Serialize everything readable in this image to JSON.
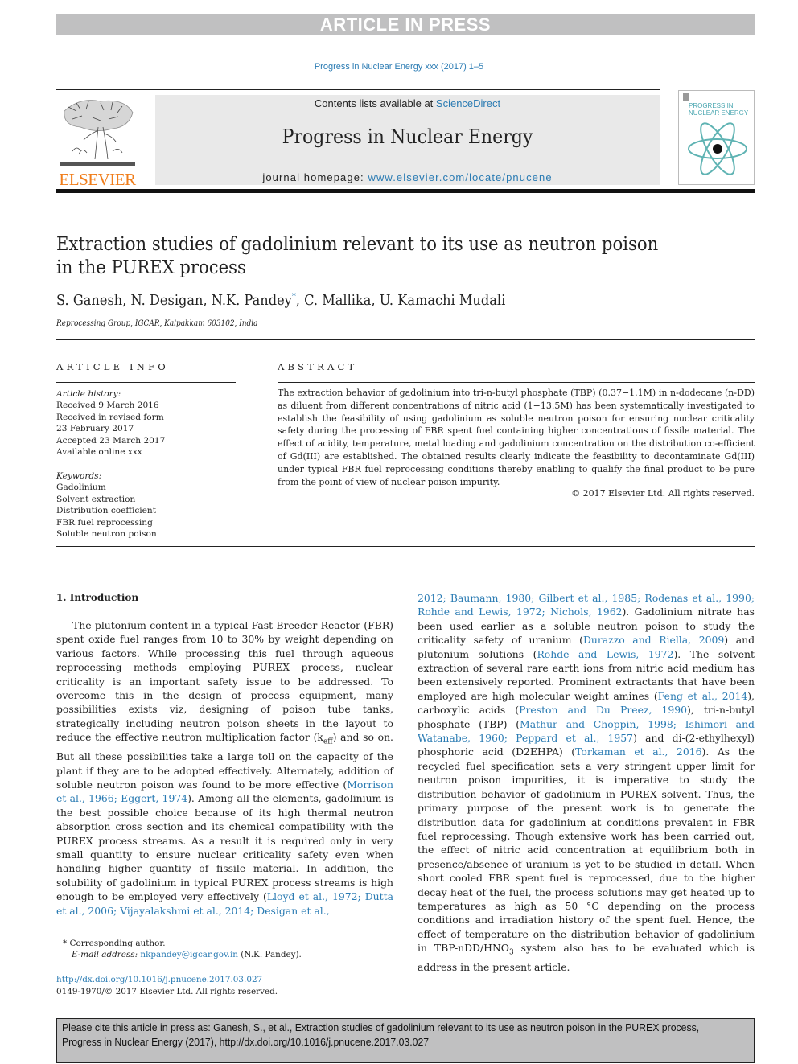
{
  "banner": "ARTICLE IN PRESS",
  "journal_ref": "Progress in Nuclear Energy xxx (2017) 1–5",
  "header": {
    "publisher_logo_text": "ELSEVIER",
    "contents_prefix": "Contents lists available at ",
    "contents_link": "ScienceDirect",
    "journal_title": "Progress in Nuclear Energy",
    "homepage_prefix": "journal homepage: ",
    "homepage_link": "www.elsevier.com/locate/pnucene",
    "cover_title_line1": "PROGRESS IN",
    "cover_title_line2": "NUCLEAR ENERGY"
  },
  "article": {
    "title_line1": "Extraction studies of gadolinium relevant to its use as neutron poison",
    "title_line2": "in the PUREX process",
    "authors_before": "S. Ganesh, N. Desigan, N.K. Pandey",
    "author_mark": "*",
    "authors_after": ", C. Mallika, U. Kamachi Mudali",
    "affiliation": "Reprocessing Group, IGCAR, Kalpakkam 603102, India"
  },
  "article_info": {
    "heading": "ARTICLE INFO",
    "history_label": "Article history:",
    "history": [
      "Received 9 March 2016",
      "Received in revised form",
      "23 February 2017",
      "Accepted 23 March 2017",
      "Available online xxx"
    ],
    "keywords_label": "Keywords:",
    "keywords": [
      "Gadolinium",
      "Solvent extraction",
      "Distribution coefficient",
      "FBR fuel reprocessing",
      "Soluble neutron poison"
    ]
  },
  "abstract": {
    "heading": "ABSTRACT",
    "text": "The extraction behavior of gadolinium into tri-n-butyl phosphate (TBP) (0.37−1.1M) in n-dodecane (n-DD) as diluent from different concentrations of nitric acid (1−13.5M) has been systematically investigated to establish the feasibility of using gadolinium as soluble neutron poison for ensuring nuclear criticality safety during the processing of FBR spent fuel containing higher concentrations of fissile material. The effect of acidity, temperature, metal loading and gadolinium concentration on the distribution co-efficient of Gd(III) are established. The obtained results clearly indicate the feasibility to decontaminate Gd(III) under typical FBR fuel reprocessing conditions thereby enabling to qualify the final product to be pure from the point of view of nuclear poison impurity.",
    "copyright": "© 2017 Elsevier Ltd. All rights reserved."
  },
  "body": {
    "section_heading": "1.  Introduction",
    "left": {
      "t1": "The plutonium content in a typical Fast Breeder Reactor (FBR) spent oxide fuel ranges from 10 to 30% by weight depending on various factors. While processing this fuel through aqueous reprocessing methods employing PUREX process, nuclear criticality is an important safety issue to be addressed. To overcome this in the design of process equipment, many possibilities exists viz, designing of poison tube tanks, strategically including neutron poison sheets in the layout to reduce the effective neutron multiplication factor (k",
      "keff_sub": "eff",
      "t2": ") and so on. But all these possibilities take a large toll on the capacity of the plant if they are to be adopted effectively. Alternately, addition of soluble neutron poison was found to be more effective (",
      "ref1": "Morrison et al., 1966; Eggert, 1974",
      "t3": "). Among all the elements, gadolinium is the best possible choice because of its high thermal neutron absorption cross section and its chemical compatibility with the PUREX process streams. As a result it is required only in very small quantity to ensure nuclear criticality safety even when handling higher quantity of fissile material. In addition, the solubility of gadolinium in typical PUREX process streams is high enough to be employed very effectively (",
      "ref2": "Lloyd et al., 1972; Dutta et al., 2006; Vijayalakshmi et al., 2014; Desigan et al.,"
    },
    "right": {
      "ref2_cont": "2012; Baumann, 1980; Gilbert et al., 1985; Rodenas et al., 1990; Rohde and Lewis, 1972; Nichols, 1962",
      "t1": "). Gadolinium nitrate has been used earlier as a soluble neutron poison to study the criticality safety of uranium (",
      "ref3": "Durazzo and Riella, 2009",
      "t2": ") and plutonium solutions (",
      "ref4": "Rohde and Lewis, 1972",
      "t3": "). The solvent extraction of several rare earth ions from nitric acid medium has been extensively reported. Prominent extractants that have been employed are high molecular weight amines (",
      "ref5": "Feng et al., 2014",
      "t4": "), carboxylic acids (",
      "ref6": "Preston and Du Preez, 1990",
      "t5": "), tri-n-butyl phosphate (TBP) (",
      "ref7": "Mathur and Choppin, 1998; Ishimori and Watanabe, 1960; Peppard et al., 1957",
      "t6": ") and di-(2-ethylhexyl) phosphoric acid (D2EHPA) (",
      "ref8": "Torkaman et al., 2016",
      "t7": "). As the recycled fuel specification sets a very stringent upper limit for neutron poison impurities, it is imperative to study the distribution behavior of gadolinium in PUREX solvent. Thus, the primary purpose of the present work is to generate the distribution data for gadolinium at conditions prevalent in FBR fuel reprocessing. Though extensive work has been carried out, the effect of nitric acid concentration at equilibrium both in presence/absence of uranium is yet to be studied in detail. When short cooled FBR spent fuel is reprocessed, due to the higher decay heat of the fuel, the process solutions may get heated up to temperatures as high as 50 °C depending on the process conditions and irradiation history of the spent fuel. Hence, the effect of temperature on the distribution behavior of gadolinium in TBP-nDD/HNO",
      "hno3_sub": "3",
      "t8": " system also has to be evaluated which is address in the present article."
    }
  },
  "footnote": {
    "mark": "*",
    "corresponding": "Corresponding author.",
    "email_label": "E-mail address:",
    "email": "nkpandey@igcar.gov.in",
    "email_suffix": " (N.K. Pandey)."
  },
  "doi": {
    "link": "http://dx.doi.org/10.1016/j.pnucene.2017.03.027",
    "issn_line": "0149-1970/© 2017 Elsevier Ltd. All rights reserved."
  },
  "cite_box": {
    "line1": "Please cite this article in press as: Ganesh, S., et al., Extraction studies of gadolinium relevant to its use as neutron poison in the PUREX process,",
    "line2": "Progress in Nuclear Energy (2017), http://dx.doi.org/10.1016/j.pnucene.2017.03.027"
  }
}
